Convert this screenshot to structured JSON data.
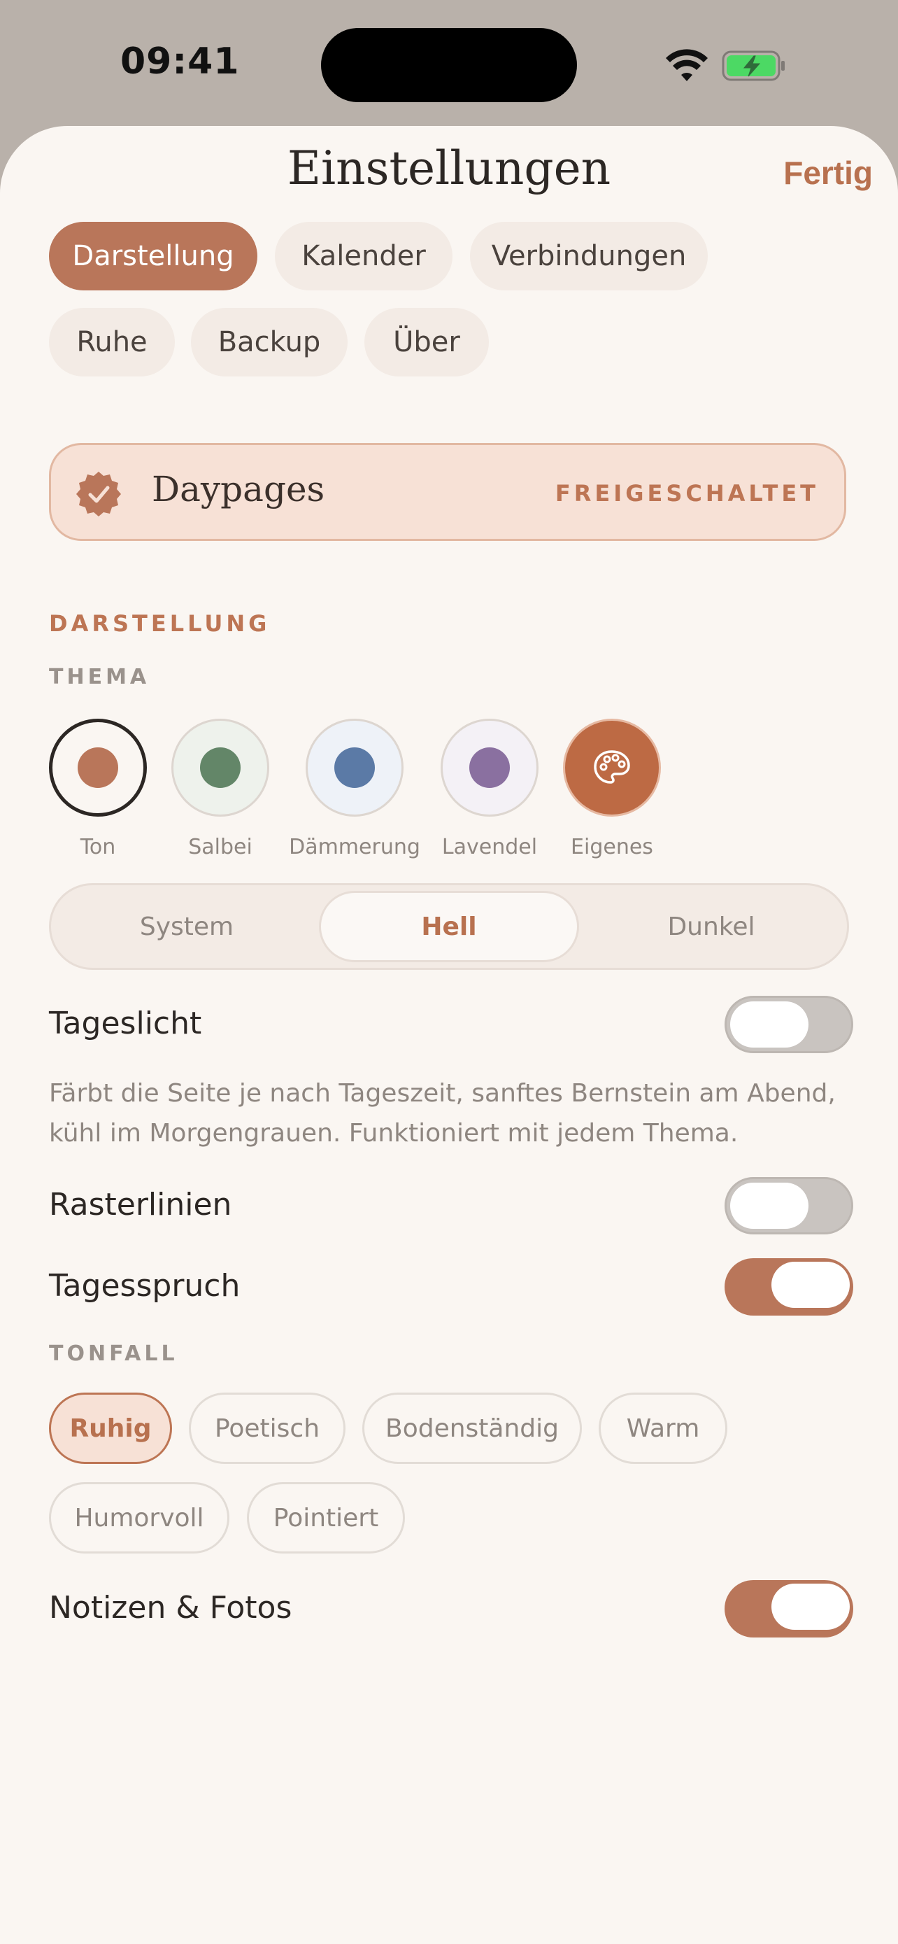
{
  "status_bar": {
    "time": "09:41"
  },
  "sheet": {
    "title": "Einstellungen",
    "done": "Fertig"
  },
  "tabs": [
    {
      "label": "Darstellung",
      "active": true
    },
    {
      "label": "Kalender"
    },
    {
      "label": "Verbindungen"
    },
    {
      "label": "Ruhe"
    },
    {
      "label": "Backup"
    },
    {
      "label": "Über"
    }
  ],
  "banner": {
    "name": "Daypages",
    "status": "FREIGESCHALTET",
    "icon": "check-badge-icon"
  },
  "appearance": {
    "section": "DARSTELLUNG",
    "theme_label": "THEMA",
    "themes": [
      {
        "label": "Ton",
        "color": "#b9765a",
        "selected": true
      },
      {
        "label": "Salbei",
        "color": "#638668"
      },
      {
        "label": "Dämmerung",
        "color": "#5b7aa6"
      },
      {
        "label": "Lavendel",
        "color": "#8a70a0"
      },
      {
        "label": "Eigenes",
        "color": "#bd6a44",
        "icon": "palette-icon"
      }
    ],
    "mode": {
      "options": [
        "System",
        "Hell",
        "Dunkel"
      ],
      "selected": "Hell"
    },
    "daylight": {
      "label": "Tageslicht",
      "on": false,
      "description": "Färbt die Seite je nach Tageszeit, sanftes Bernstein am Abend, kühl im Morgengrauen. Funktioniert mit jedem Thema."
    },
    "gridlines": {
      "label": "Rasterlinien",
      "on": false
    },
    "daily_quote": {
      "label": "Tagesspruch",
      "on": true
    },
    "tone_label": "TONFALL",
    "tones": [
      "Ruhig",
      "Poetisch",
      "Bodenständig",
      "Warm",
      "Humorvoll",
      "Pointiert"
    ],
    "tone_selected": "Ruhig",
    "notes_photos": {
      "label": "Notizen & Fotos",
      "on": true
    }
  },
  "colors": {
    "accent": "#b9765a",
    "background": "#faf6f2",
    "banner": "#f7e1d6"
  }
}
